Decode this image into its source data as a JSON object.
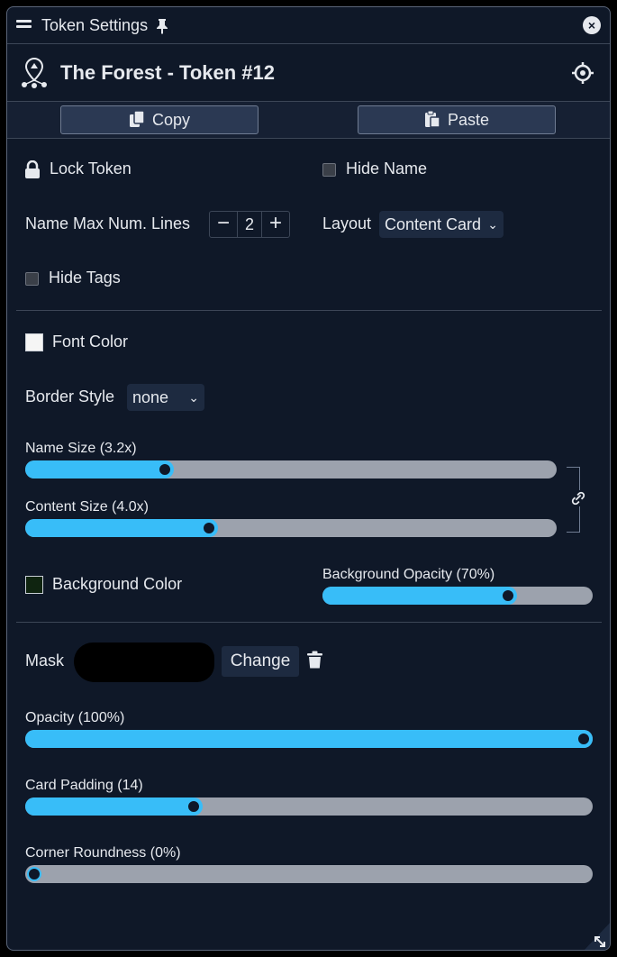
{
  "titlebar": {
    "title": "Token Settings",
    "close_glyph": "×"
  },
  "header": {
    "token_name": "The Forest - Token #12"
  },
  "clipboard": {
    "copy_label": "Copy",
    "paste_label": "Paste"
  },
  "general": {
    "lock_label": "Lock Token",
    "hide_name_label": "Hide Name",
    "hide_name_checked": false,
    "name_lines_label": "Name Max Num. Lines",
    "name_lines_value": "2",
    "minus_glyph": "−",
    "plus_glyph": "+",
    "layout_label": "Layout",
    "layout_value": "Content Card",
    "hide_tags_label": "Hide Tags",
    "hide_tags_checked": false
  },
  "style": {
    "font_color_label": "Font Color",
    "font_color": "#f5f5f5",
    "border_style_label": "Border Style",
    "border_style_value": "none",
    "chevron_glyph": "⌄",
    "name_size_label": "Name Size (3.2x)",
    "name_size_fraction": 0.255,
    "content_size_label": "Content Size (4.0x)",
    "content_size_fraction": 0.34,
    "background_color_label": "Background Color",
    "background_color": "#0f2410",
    "background_opacity_label": "Background Opacity (70%)",
    "background_opacity_fraction": 0.7
  },
  "mask": {
    "mask_label": "Mask",
    "change_label": "Change",
    "opacity_label": "Opacity (100%)",
    "opacity_fraction": 1.0,
    "card_padding_label": "Card Padding (14)",
    "card_padding_fraction": 0.29,
    "corner_roundness_label": "Corner Roundness (0%)",
    "corner_roundness_fraction": 0.0
  },
  "colors": {
    "accent": "#38bdf8",
    "panel": "#0f1828",
    "track": "#9ca2ad"
  }
}
